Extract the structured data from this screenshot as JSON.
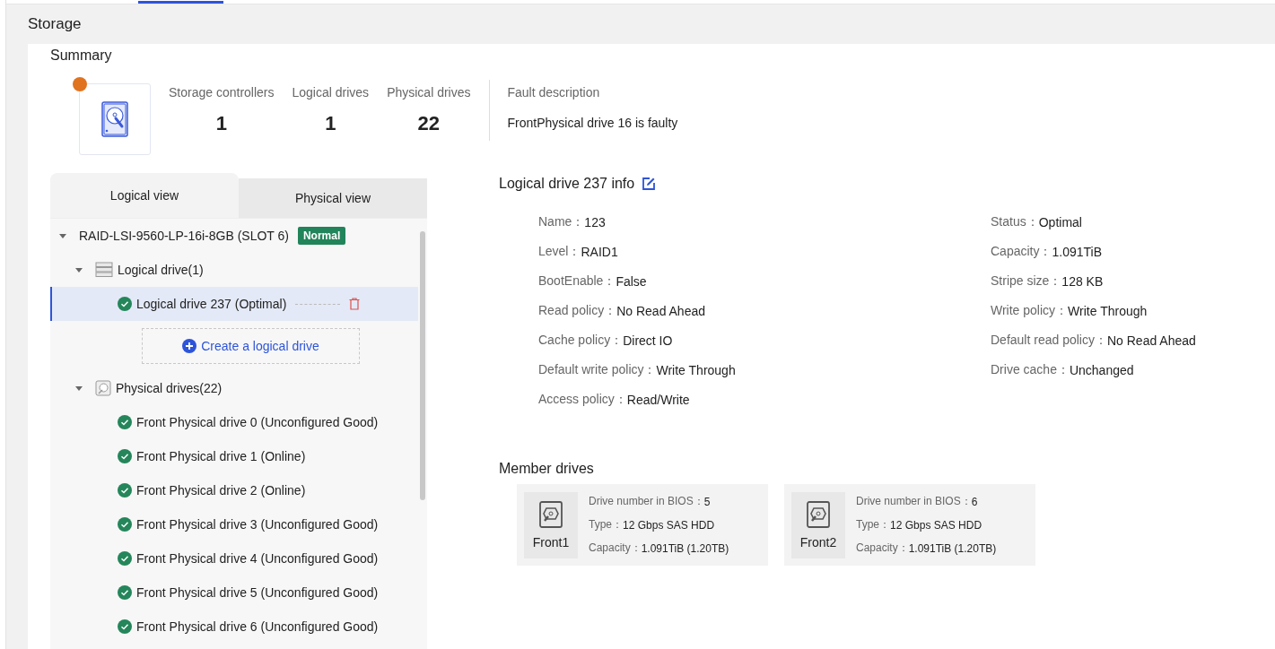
{
  "page_title": "Storage",
  "summary": {
    "title": "Summary",
    "alert": true,
    "stats": [
      {
        "label": "Storage controllers",
        "value": "1"
      },
      {
        "label": "Logical drives",
        "value": "1"
      },
      {
        "label": "Physical drives",
        "value": "22"
      }
    ],
    "fault": {
      "label": "Fault description",
      "text": "FrontPhysical drive 16 is faulty"
    }
  },
  "view_tabs": [
    {
      "label": "Logical view",
      "selected": true
    },
    {
      "label": "Physical view",
      "selected": false
    }
  ],
  "tree": {
    "label": "RAID-LSI-9560-LP-16i-8GB (SLOT 6)",
    "badge": "Normal",
    "expanded": true,
    "children": [
      {
        "kind": "logical",
        "label": "Logical drive(1)",
        "expanded": true,
        "create_button": "Create a logical drive",
        "children": [
          {
            "label": "Logical drive 237 (Optimal)",
            "selected": true
          }
        ]
      },
      {
        "kind": "physical",
        "label": "Physical drives(22)",
        "expanded": true,
        "children": [
          {
            "label": "Front Physical drive 0 (Unconfigured Good)",
            "selected": false
          },
          {
            "label": "Front Physical drive 1 (Online)",
            "selected": false
          },
          {
            "label": "Front Physical drive 2 (Online)",
            "selected": false
          },
          {
            "label": "Front Physical drive 3 (Unconfigured Good)",
            "selected": false
          },
          {
            "label": "Front Physical drive 4 (Unconfigured Good)",
            "selected": false
          },
          {
            "label": "Front Physical drive 5 (Unconfigured Good)",
            "selected": false
          },
          {
            "label": "Front Physical drive 6 (Unconfigured Good)",
            "selected": false
          }
        ]
      }
    ]
  },
  "info": {
    "title": "Logical drive 237 info",
    "left": [
      {
        "label": "Name：",
        "value": "123"
      },
      {
        "label": "Level：",
        "value": "RAID1"
      },
      {
        "label": "BootEnable：",
        "value": "False"
      },
      {
        "label": "Read policy：",
        "value": "No Read Ahead"
      },
      {
        "label": "Cache policy：",
        "value": "Direct IO"
      },
      {
        "label": "Default write policy：",
        "value": "Write Through"
      },
      {
        "label": "Access policy：",
        "value": "Read/Write"
      }
    ],
    "right": [
      {
        "label": "Status：",
        "value": "Optimal"
      },
      {
        "label": "Capacity：",
        "value": "1.091TiB"
      },
      {
        "label": "Stripe size：",
        "value": "128 KB"
      },
      {
        "label": "Write policy：",
        "value": "Write Through"
      },
      {
        "label": "Default read policy：",
        "value": "No Read Ahead"
      },
      {
        "label": "Drive cache：",
        "value": "Unchanged"
      }
    ]
  },
  "member_drives": {
    "title": "Member drives",
    "drives": [
      {
        "name": "Front1",
        "fields": [
          {
            "label": "Drive number in BIOS：",
            "value": "5"
          },
          {
            "label": "Type：",
            "value": "12 Gbps SAS HDD"
          },
          {
            "label": "Capacity：",
            "value": "1.091TiB (1.20TB)"
          }
        ]
      },
      {
        "name": "Front2",
        "fields": [
          {
            "label": "Drive number in BIOS：",
            "value": "6"
          },
          {
            "label": "Type：",
            "value": "12 Gbps SAS HDD"
          },
          {
            "label": "Capacity：",
            "value": "1.091TiB (1.20TB)"
          }
        ]
      }
    ]
  }
}
